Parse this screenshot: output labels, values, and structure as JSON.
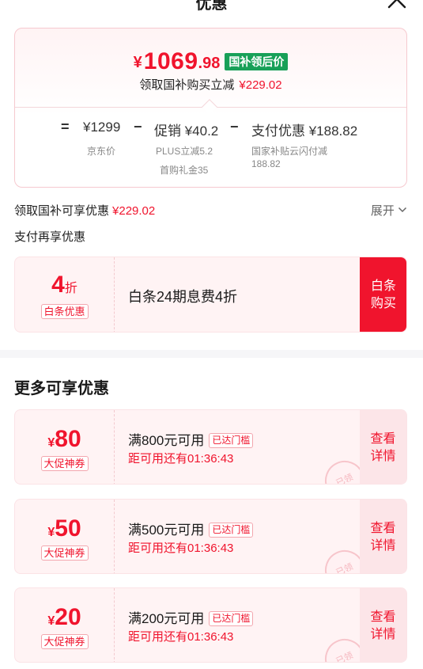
{
  "header": {
    "title": "优惠"
  },
  "price_card": {
    "currency": "¥",
    "final_int": "1069",
    "final_dec": ".98",
    "badge": "国补领后价",
    "claim_label": "领取国补购买立减",
    "claim_amount": "¥229.02",
    "breakdown": {
      "eq": "=",
      "jd_price": "¥1299",
      "jd_price_label": "京东价",
      "minus1": "−",
      "promo": "促销 ¥40.2",
      "promo_sub1": "PLUS立减5.2",
      "promo_sub2": "首购礼金35",
      "minus2": "−",
      "pay": "支付优惠 ¥188.82",
      "pay_sub1": "国家补贴云闪付减",
      "pay_sub2": "188.82"
    }
  },
  "claim_line": {
    "label": "领取国补可享优惠",
    "amount": "¥229.02",
    "expand": "展开"
  },
  "pay_section": {
    "title": "支付再享优惠"
  },
  "baitiao": {
    "num": "4",
    "unit": "折",
    "tag": "白条优惠",
    "text": "白条24期息费4折",
    "button_line1": "白条",
    "button_line2": "购买"
  },
  "more": {
    "title": "更多可享优惠"
  },
  "coupons": [
    {
      "yen": "¥",
      "value": "80",
      "tag": "大促神券",
      "condition": "满800元可用",
      "reached": "已达门槛",
      "countdown": "距可用还有01:36:43",
      "detail1": "查看",
      "detail2": "详情",
      "stamp": "已领"
    },
    {
      "yen": "¥",
      "value": "50",
      "tag": "大促神券",
      "condition": "满500元可用",
      "reached": "已达门槛",
      "countdown": "距可用还有01:36:43",
      "detail1": "查看",
      "detail2": "详情",
      "stamp": "已领"
    },
    {
      "yen": "¥",
      "value": "20",
      "tag": "大促神券",
      "condition": "满200元可用",
      "reached": "已达门槛",
      "countdown": "距可用还有01:36:43",
      "detail1": "查看",
      "detail2": "详情",
      "stamp": "已领"
    }
  ],
  "colors": {
    "accent": "#f0142d",
    "badge_green": "#18a058"
  }
}
